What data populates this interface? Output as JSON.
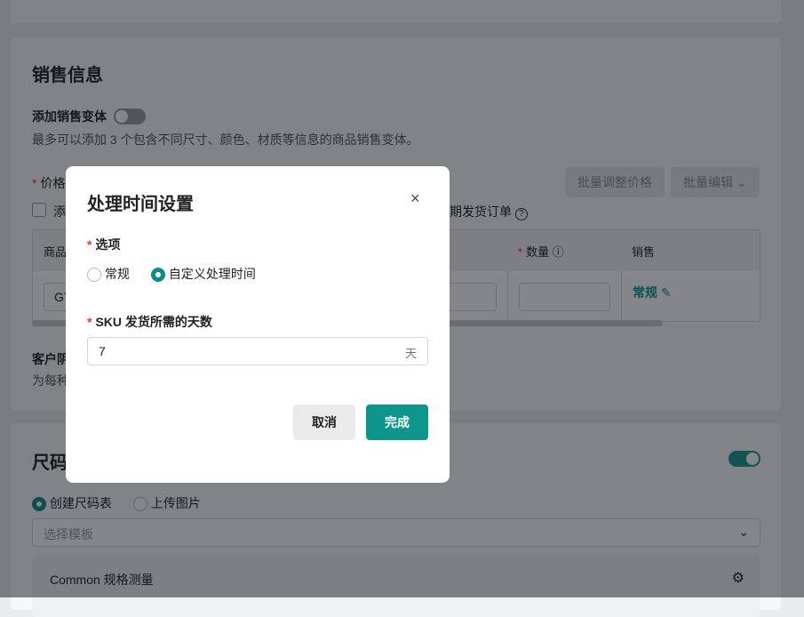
{
  "sales": {
    "title": "销售信息",
    "variant_label": "添加销售变体",
    "variant_desc": "最多可以添加 3 个包含不同尺寸、颜色、材质等信息的商品销售变体。",
    "price_label": "价格",
    "batch_price": "批量调整价格",
    "batch_edit": "批量编辑",
    "checkbox_label_start": "添",
    "checkbox_label_end": "期发货订单",
    "table_headers": {
      "product": "商品",
      "quantity": "数量",
      "sales": "销售"
    },
    "row": {
      "sku_prefix": "GT",
      "sales_value": "常规"
    },
    "customer_label": "客户阴",
    "customer_desc": "为每种"
  },
  "size": {
    "title": "尺码",
    "options": [
      "创建尺码表",
      "上传图片"
    ],
    "template_placeholder": "选择模板",
    "common_label": "Common 规格测量"
  },
  "modal": {
    "title": "处理时间设置",
    "option_label": "选项",
    "options": [
      "常规",
      "自定义处理时间"
    ],
    "selected": "自定义处理时间",
    "days_label": "SKU 发货所需的天数",
    "days_value": "7",
    "days_unit": "天",
    "cancel": "取消",
    "confirm": "完成"
  },
  "colors": {
    "accent": "#0e968c"
  }
}
